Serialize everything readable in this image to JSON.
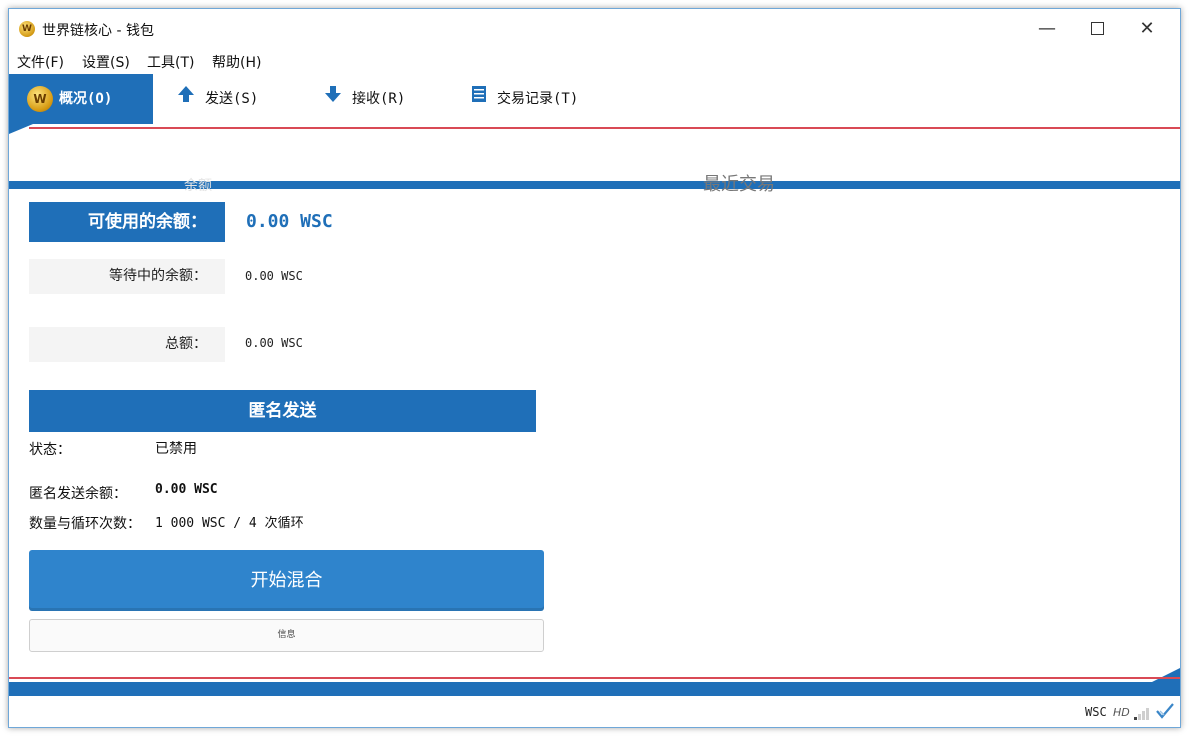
{
  "window": {
    "title": "世界链核心 - 钱包",
    "icon_letter": "W"
  },
  "menu": {
    "items": [
      {
        "label": "文件(F)"
      },
      {
        "label": "设置(S)"
      },
      {
        "label": "工具(T)"
      },
      {
        "label": "帮助(H)"
      }
    ]
  },
  "tabs": [
    {
      "label": "概况(O)",
      "icon": "coin-logo-icon",
      "active": true
    },
    {
      "label": "发送(S)",
      "icon": "arrow-up-icon"
    },
    {
      "label": "接收(R)",
      "icon": "arrow-down-icon"
    },
    {
      "label": "交易记录(T)",
      "icon": "list-icon"
    }
  ],
  "overview": {
    "balance_section_title": "余额",
    "recent_transactions_title": "最近交易",
    "available_label": "可使用的余额：",
    "available_value": "0.00  WSC",
    "pending_label": "等待中的余额：",
    "pending_value": "0.00  WSC",
    "total_label": "总额：",
    "total_value": "0.00  WSC"
  },
  "anonymous_send": {
    "header": "匿名发送",
    "status_label": "状态：",
    "status_value": "已禁用",
    "balance_label": "匿名发送余额：",
    "balance_value": "0.00  WSC",
    "rounds_label": "数量与循环次数：",
    "rounds_value": "1 000  WSC / 4 次循环",
    "start_button": "开始混合",
    "info_button": "信息"
  },
  "statusbar": {
    "unit": "WSC",
    "hd_label": "HD"
  },
  "colors": {
    "accent": "#1f6fb8",
    "button": "#2f84cc",
    "stripe_red": "#d94a55"
  }
}
